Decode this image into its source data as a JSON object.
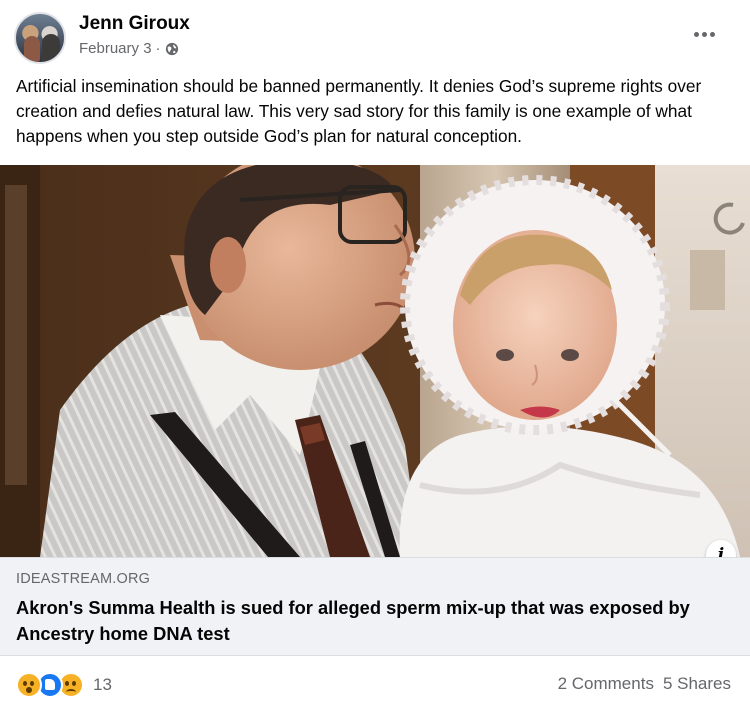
{
  "post": {
    "author": "Jenn Giroux",
    "date": "February 3",
    "separator": "·",
    "privacy_icon": "globe-icon",
    "text": "Artificial insemination should be banned permanently. It denies God’s supreme rights over creation and defies natural law. This very sad story for this family is one example of what happens when you step outside God’s plan for natural conception."
  },
  "link_preview": {
    "domain": "IDEASTREAM.ORG",
    "title": "Akron's Summa Health is sued for alleged sperm mix-up that was exposed by Ancestry home DNA test",
    "info_icon": "info-icon",
    "info_glyph": "i"
  },
  "footer": {
    "reaction_icons": [
      "wow-reaction-icon",
      "like-reaction-icon",
      "sad-reaction-icon"
    ],
    "reaction_count": "13",
    "comments": "2 Comments",
    "shares": "5 Shares"
  },
  "colors": {
    "text_primary": "#050505",
    "text_secondary": "#65676b",
    "link_bg": "#f0f2f5",
    "like_blue": "#1877f2",
    "reaction_yellow": "#f7b125"
  }
}
